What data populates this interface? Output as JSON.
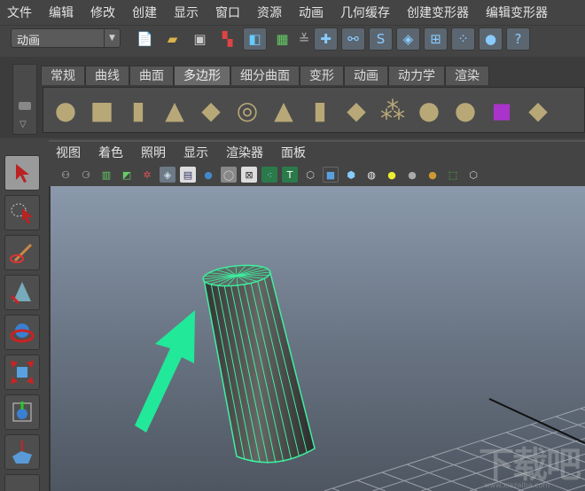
{
  "menubar": [
    "文件",
    "编辑",
    "修改",
    "创建",
    "显示",
    "窗口",
    "资源",
    "动画",
    "几何缓存",
    "创建变形器",
    "编辑变形器"
  ],
  "statusline": {
    "mode": "动画",
    "icons": [
      "new-scene-icon",
      "open-scene-icon",
      "save-scene-icon",
      "select-hierarchy-icon",
      "select-object-icon",
      "select-component-icon",
      "snap-grid-icon",
      "snap-curve-icon",
      "snap-point-icon",
      "snap-plane-icon",
      "snap-live-icon",
      "snap-vertex-icon",
      "snap-particle-icon",
      "help-icon"
    ]
  },
  "shelf": {
    "tabs": [
      "常规",
      "曲线",
      "曲面",
      "多边形",
      "细分曲面",
      "变形",
      "动画",
      "动力学",
      "渲染"
    ],
    "active_tab": "多边形",
    "items": [
      "poly-sphere",
      "poly-cube",
      "poly-cylinder",
      "poly-cone",
      "poly-plane",
      "poly-torus",
      "poly-pyramid",
      "poly-pipe",
      "poly-platonic",
      "combine",
      "separate",
      "extract",
      "smooth-proxy",
      "mirror"
    ]
  },
  "panel": {
    "menu": [
      "视图",
      "着色",
      "照明",
      "显示",
      "渲染器",
      "面板"
    ]
  },
  "watermark": {
    "text": "下载吧",
    "url": "www.xiazaiba.com"
  }
}
